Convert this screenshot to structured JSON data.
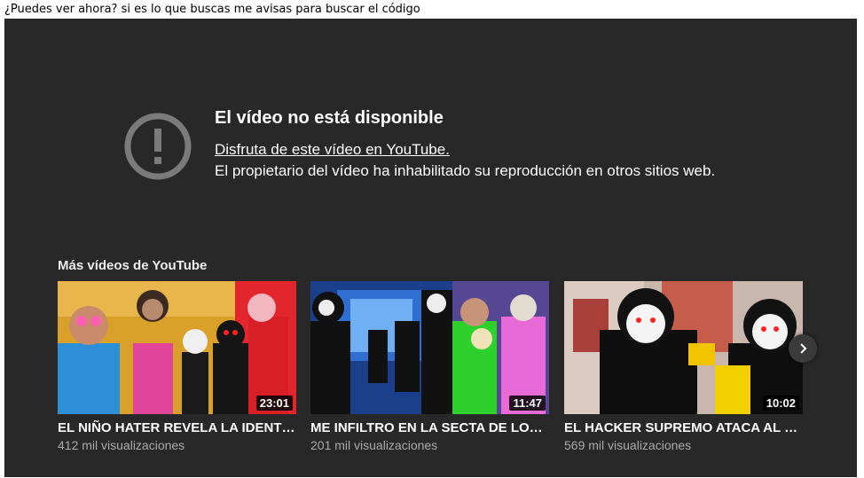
{
  "caption": "¿Puedes ver ahora? si es lo que buscas me avisas para buscar el código",
  "player": {
    "error_icon": "exclamation-circle-icon",
    "error_title": "El vídeo no está disponible",
    "error_link": "Disfruta de este vídeo en YouTube.",
    "error_description": "El propietario del vídeo ha inhabilitado su reproducción en otros sitios web."
  },
  "more_videos": {
    "heading": "Más vídeos de YouTube",
    "next_icon": "chevron-right-icon",
    "videos": [
      {
        "title": "EL NIÑO HATER REVELA LA IDENTIDAD DE SU MADRE",
        "views": "412 mil visualizaciones",
        "duration": "23:01"
      },
      {
        "title": "ME INFILTRO EN LA SECTA DE LOS HACKERS",
        "views": "201 mil visualizaciones",
        "duration": "11:47"
      },
      {
        "title": "EL HACKER SUPREMO ATACA AL HACKER",
        "views": "569 mil visualizaciones",
        "duration": "10:02"
      }
    ]
  },
  "colors": {
    "player_bg": "#282828",
    "text": "#ffffff",
    "muted": "#aaaaaa"
  }
}
